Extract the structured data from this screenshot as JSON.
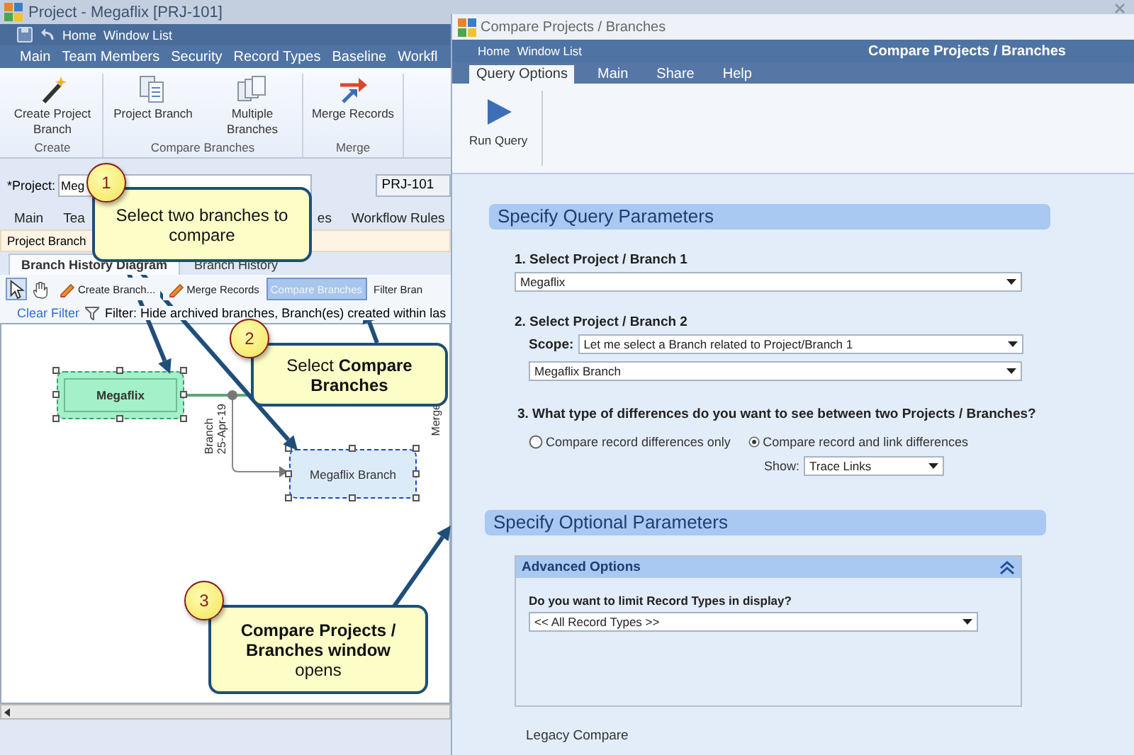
{
  "project_window": {
    "title": "Project - Megaflix [PRJ-101]",
    "quick_links": [
      "Home",
      "Window List"
    ],
    "menu_tabs": [
      "Main",
      "Team Members",
      "Security",
      "Record Types",
      "Baseline",
      "Workfl"
    ],
    "ribbon_groups": [
      {
        "label": "Create",
        "buttons": [
          {
            "label": "Create Project Branch",
            "kind": "wand"
          }
        ]
      },
      {
        "label": "Compare Branches",
        "buttons": [
          {
            "label": "Project Branch",
            "kind": "document"
          },
          {
            "label": "Multiple Branches",
            "kind": "documents"
          }
        ]
      },
      {
        "label": "Merge",
        "buttons": [
          {
            "label": "Merge Records",
            "kind": "merge"
          }
        ]
      }
    ],
    "project_field": {
      "label": "*Project:",
      "value": "Meg"
    },
    "project_id": "PRJ-101",
    "tabs": [
      "Main",
      "Tea",
      "es",
      "Workflow Rules"
    ],
    "section_tab": "Project Branch",
    "view_tabs": [
      {
        "label": "Branch History Diagram",
        "selected": true
      },
      {
        "label": "Branch History",
        "selected": false
      }
    ],
    "tools": [
      {
        "kind": "pointer",
        "selected": true
      },
      {
        "kind": "hand",
        "selected": false
      }
    ],
    "actions": [
      {
        "label": "Create Branch...",
        "kind": "pencil",
        "highlighted": false
      },
      {
        "label": "Merge Records",
        "kind": "pencil",
        "highlighted": false
      },
      {
        "label": "Compare Branches",
        "kind": "plain",
        "highlighted": true
      },
      {
        "label": "Filter Bran",
        "kind": "plain",
        "highlighted": false
      }
    ],
    "filter": {
      "link": "Clear Filter",
      "text": "Filter: Hide archived branches, Branch(es) created within las"
    },
    "diagram": {
      "nodes": [
        {
          "label": "Megaflix",
          "kind": "project",
          "selected": true
        },
        {
          "label": "Megaflix Branch",
          "kind": "branch",
          "selected": true
        }
      ],
      "edge_label": [
        "Branch",
        "25-Apr-19"
      ],
      "merge_label": "Merge"
    }
  },
  "compare_window": {
    "title": "Compare Projects / Branches",
    "quick_links": [
      "Home",
      "Window List"
    ],
    "header": "Compare Projects / Branches",
    "tabs": [
      {
        "label": "Query Options",
        "selected": true
      },
      {
        "label": "Main",
        "selected": false
      },
      {
        "label": "Share",
        "selected": false
      },
      {
        "label": "Help",
        "selected": false
      }
    ],
    "ribbon_button": "Run Query",
    "query_section": {
      "title": "Specify Query Parameters",
      "step1": {
        "label": "1. Select Project / Branch 1",
        "value": "Megaflix"
      },
      "step2": {
        "label": "2. Select Project / Branch 2",
        "scope_label": "Scope:",
        "scope_value": "Let me select a Branch related to Project/Branch 1",
        "value": "Megaflix Branch"
      },
      "step3": {
        "label": "3. What type of differences do you want to see between two Projects / Branches?",
        "options": [
          {
            "label": "Compare record differences only",
            "selected": false
          },
          {
            "label": "Compare record and link differences",
            "selected": true
          }
        ],
        "show_label": "Show:",
        "show_value": "Trace Links"
      }
    },
    "optional_section": {
      "title": "Specify Optional Parameters",
      "panel": {
        "title": "Advanced Options",
        "expanded": true,
        "question": "Do you want to limit Record Types in display?",
        "value": "<< All Record Types >>"
      },
      "next_heading": "Legacy Compare"
    }
  },
  "callouts": [
    {
      "number": "1",
      "text": "Select two branches to compare"
    },
    {
      "number": "2",
      "text": "Select **Compare Branches**"
    },
    {
      "number": "3",
      "text": "**Compare Projects / Branches window** opens"
    }
  ]
}
